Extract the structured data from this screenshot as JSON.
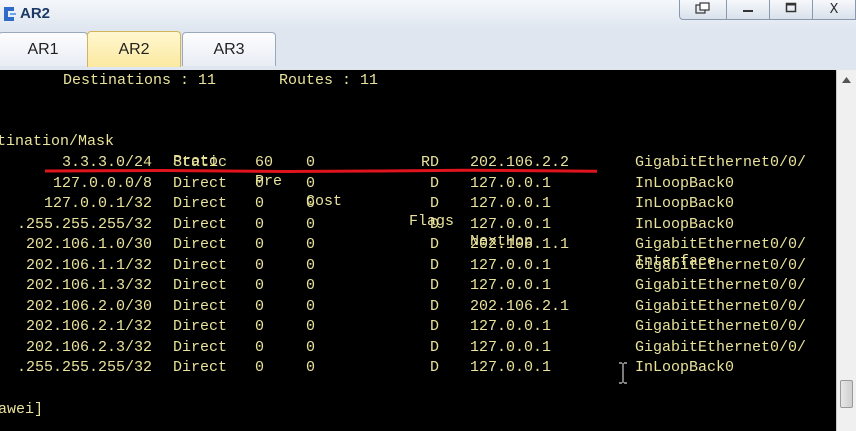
{
  "window": {
    "title": "AR2",
    "controls": {
      "restore": "▭",
      "minimize": "—",
      "maximize": "□",
      "close": "X"
    }
  },
  "tabs": [
    {
      "label": "AR1",
      "active": false
    },
    {
      "label": "AR2",
      "active": true
    },
    {
      "label": "AR3",
      "active": false
    }
  ],
  "terminal": {
    "summary": "       Destinations : 11       Routes : 11",
    "headers": {
      "destination": "tination/Mask",
      "proto": "Proto",
      "pre": "Pre",
      "cost": "Cost",
      "flags": "Flags",
      "nexthop": "NextHop",
      "interface": "Interface"
    },
    "rows": [
      {
        "dest": "3.3.3.0/24",
        "proto": "Static",
        "pre": "60",
        "cost": "0",
        "flags": "RD",
        "nexthop": "202.106.2.2",
        "iface": "GigabitEthernet0/0/"
      },
      {
        "dest": "127.0.0.0/8",
        "proto": "Direct",
        "pre": "0",
        "cost": "0",
        "flags": "D",
        "nexthop": "127.0.0.1",
        "iface": "InLoopBack0"
      },
      {
        "dest": "127.0.0.1/32",
        "proto": "Direct",
        "pre": "0",
        "cost": "0",
        "flags": "D",
        "nexthop": "127.0.0.1",
        "iface": "InLoopBack0"
      },
      {
        "dest": ".255.255.255/32",
        "proto": "Direct",
        "pre": "0",
        "cost": "0",
        "flags": "D",
        "nexthop": "127.0.0.1",
        "iface": "InLoopBack0"
      },
      {
        "dest": "202.106.1.0/30",
        "proto": "Direct",
        "pre": "0",
        "cost": "0",
        "flags": "D",
        "nexthop": "202.106.1.1",
        "iface": "GigabitEthernet0/0/"
      },
      {
        "dest": "202.106.1.1/32",
        "proto": "Direct",
        "pre": "0",
        "cost": "0",
        "flags": "D",
        "nexthop": "127.0.0.1",
        "iface": "GigabitEthernet0/0/"
      },
      {
        "dest": "202.106.1.3/32",
        "proto": "Direct",
        "pre": "0",
        "cost": "0",
        "flags": "D",
        "nexthop": "127.0.0.1",
        "iface": "GigabitEthernet0/0/"
      },
      {
        "dest": "202.106.2.0/30",
        "proto": "Direct",
        "pre": "0",
        "cost": "0",
        "flags": "D",
        "nexthop": "202.106.2.1",
        "iface": "GigabitEthernet0/0/"
      },
      {
        "dest": "202.106.2.1/32",
        "proto": "Direct",
        "pre": "0",
        "cost": "0",
        "flags": "D",
        "nexthop": "127.0.0.1",
        "iface": "GigabitEthernet0/0/"
      },
      {
        "dest": "202.106.2.3/32",
        "proto": "Direct",
        "pre": "0",
        "cost": "0",
        "flags": "D",
        "nexthop": "127.0.0.1",
        "iface": "GigabitEthernet0/0/"
      },
      {
        "dest": ".255.255.255/32",
        "proto": "Direct",
        "pre": "0",
        "cost": "0",
        "flags": "D",
        "nexthop": "127.0.0.1",
        "iface": "InLoopBack0"
      }
    ],
    "prompt": "awei]"
  },
  "colors": {
    "terminal_bg": "#000000",
    "terminal_text": "#e8e29a",
    "highlight_line": "#e0141e",
    "active_tab": "#fbe9a1"
  },
  "icons": {
    "app": "router-app-icon",
    "cursor": "text-cursor-icon"
  }
}
